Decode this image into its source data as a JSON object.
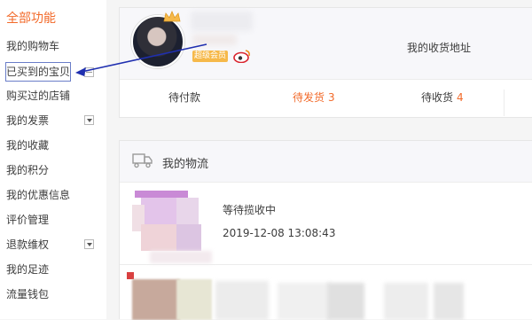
{
  "sidebar": {
    "title": "全部功能",
    "items": [
      {
        "label": "我的购物车",
        "toggle": ""
      },
      {
        "label": "已买到的宝贝",
        "toggle": "collapsed"
      },
      {
        "label": "购买过的店铺",
        "toggle": ""
      },
      {
        "label": "我的发票",
        "toggle": "down"
      },
      {
        "label": "我的收藏",
        "toggle": ""
      },
      {
        "label": "我的积分",
        "toggle": ""
      },
      {
        "label": "我的优惠信息",
        "toggle": ""
      },
      {
        "label": "评价管理",
        "toggle": ""
      },
      {
        "label": "退款维权",
        "toggle": "down"
      },
      {
        "label": "我的足迹",
        "toggle": ""
      },
      {
        "label": "流量钱包",
        "toggle": ""
      }
    ]
  },
  "profile": {
    "level_badge": "超级会员",
    "address_link": "我的收货地址",
    "orders": [
      {
        "label": "待付款",
        "count": ""
      },
      {
        "label": "待发货",
        "count": "3"
      },
      {
        "label": "待收货",
        "count": "4"
      }
    ]
  },
  "logistics": {
    "title": "我的物流",
    "status": "等待揽收中",
    "timestamp": "2019-12-08 13:08:43"
  },
  "colors": {
    "accent": "#f26a2a",
    "arrow": "#1f2fb0"
  },
  "icons": [
    "crown-icon",
    "weibo-icon",
    "truck-icon",
    "chevron-down-icon",
    "collapse-icon"
  ]
}
